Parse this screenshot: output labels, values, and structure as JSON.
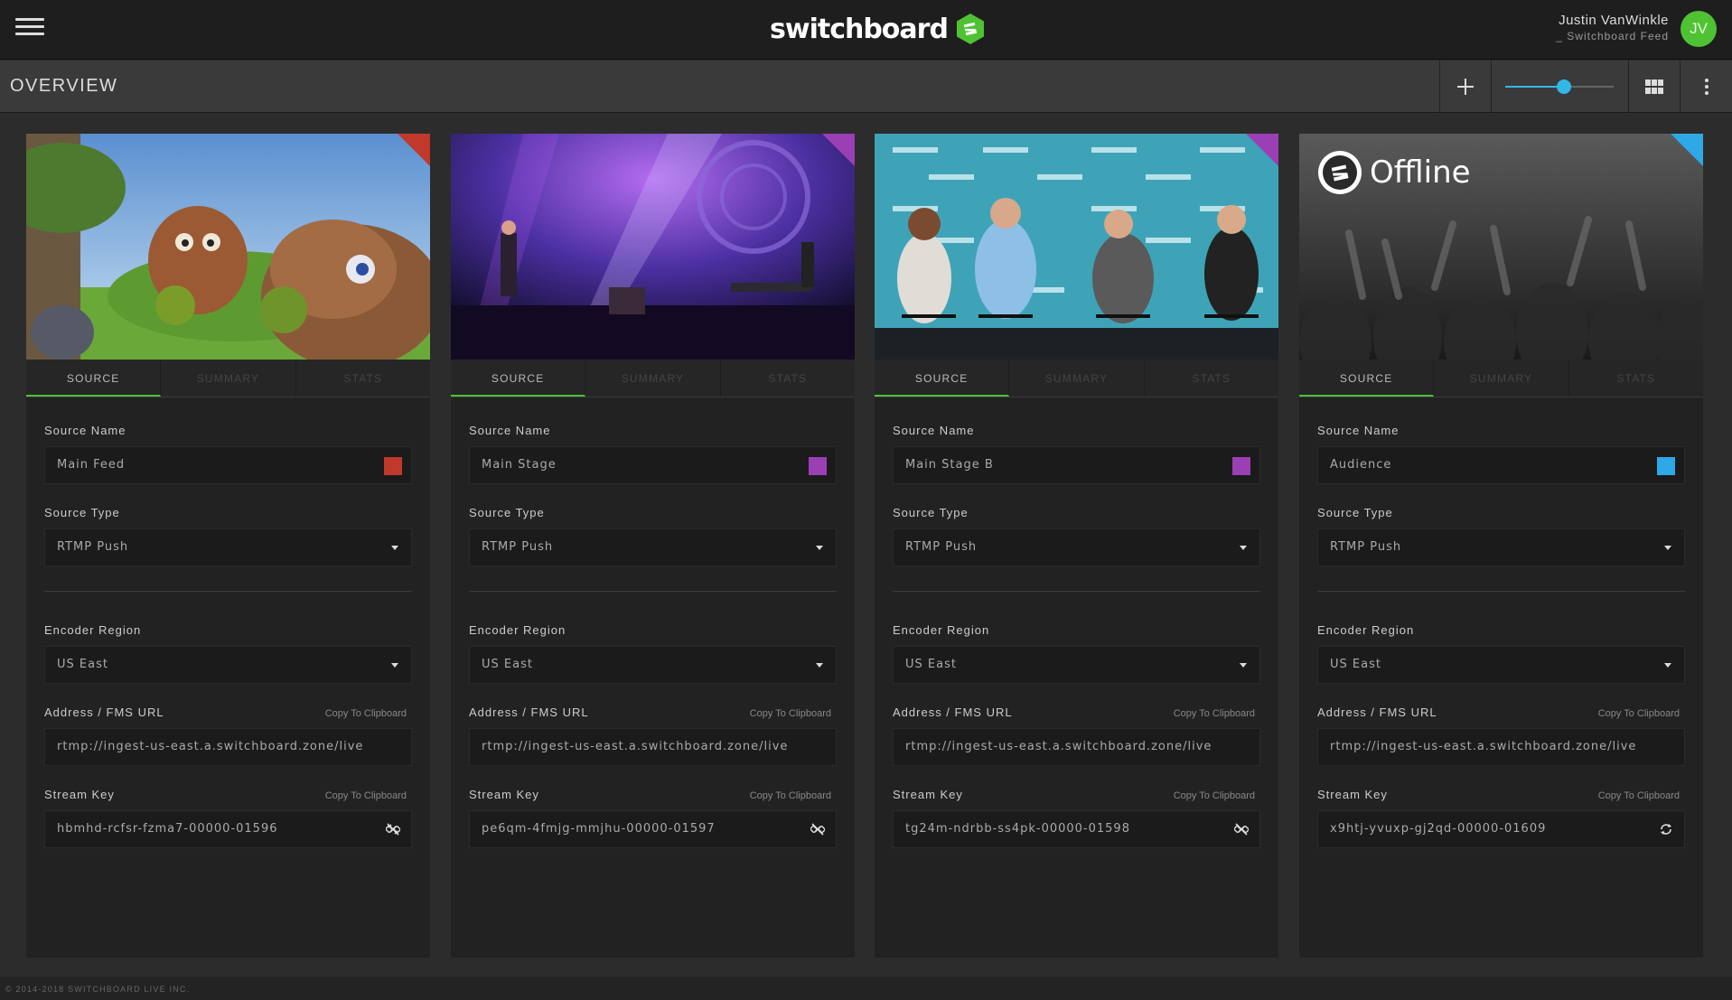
{
  "app": {
    "logo_text": "switchboard",
    "page_title": "OVERVIEW",
    "footer": "© 2014-2018 SWITCHBOARD LIVE INC."
  },
  "user": {
    "name": "Justin VanWinkle",
    "subtitle": "_ Switchboard Feed",
    "initials": "JV"
  },
  "toolbar": {
    "add_icon": "plus-icon",
    "zoom_slider_value": 0.54,
    "grid_icon": "grid-icon",
    "more_icon": "vertical-dots-icon"
  },
  "labels": {
    "source_name": "Source Name",
    "source_type": "Source Type",
    "encoder_region": "Encoder Region",
    "address": "Address / FMS URL",
    "stream_key": "Stream Key",
    "copy": "Copy To Clipboard"
  },
  "tabs": [
    "SOURCE",
    "SUMMARY",
    "STATS"
  ],
  "cards": [
    {
      "source_name": "Main Feed",
      "color": "#c0392b",
      "source_type": "RTMP Push",
      "encoder_region": "US East",
      "address": "rtmp://ingest-us-east.a.switchboard.zone/live",
      "stream_key": "hbmhd-rcfsr-fzma7-00000-01596",
      "key_icon": "unlink-icon",
      "status": "live"
    },
    {
      "source_name": "Main Stage",
      "color": "#9b3fb5",
      "source_type": "RTMP Push",
      "encoder_region": "US East",
      "address": "rtmp://ingest-us-east.a.switchboard.zone/live",
      "stream_key": "pe6qm-4fmjg-mmjhu-00000-01597",
      "key_icon": "unlink-icon",
      "status": "live"
    },
    {
      "source_name": "Main Stage B",
      "color": "#9b3fb5",
      "source_type": "RTMP Push",
      "encoder_region": "US East",
      "address": "rtmp://ingest-us-east.a.switchboard.zone/live",
      "stream_key": "tg24m-ndrbb-ss4pk-00000-01598",
      "key_icon": "unlink-icon",
      "status": "live"
    },
    {
      "source_name": "Audience",
      "color": "#2ea8e6",
      "source_type": "RTMP Push",
      "encoder_region": "US East",
      "address": "rtmp://ingest-us-east.a.switchboard.zone/live",
      "stream_key": "x9htj-yvuxp-gj2qd-00000-01609",
      "key_icon": "refresh-icon",
      "status": "Offline"
    }
  ]
}
